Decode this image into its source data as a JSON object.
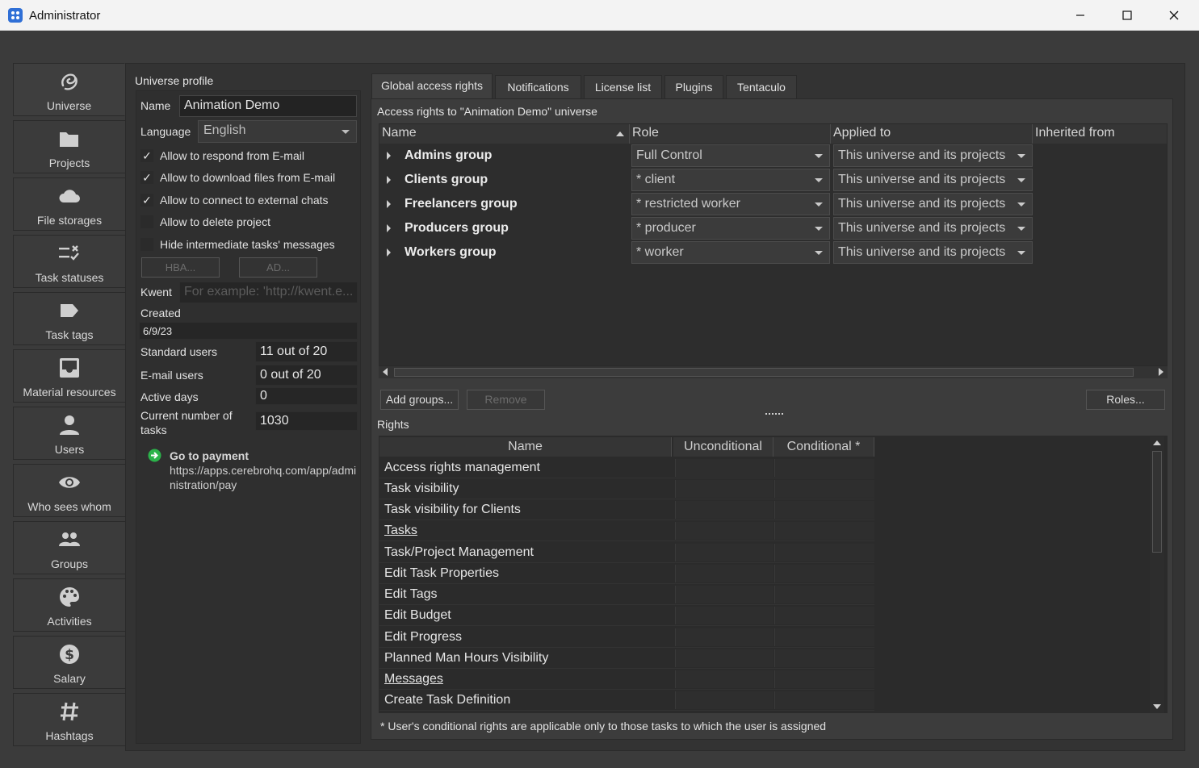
{
  "window": {
    "title": "Administrator"
  },
  "sidebar": {
    "items": [
      {
        "label": "Universe",
        "icon": "universe-icon"
      },
      {
        "label": "Projects",
        "icon": "folder-icon"
      },
      {
        "label": "File storages",
        "icon": "cloud-icon"
      },
      {
        "label": "Task statuses",
        "icon": "task-status-icon"
      },
      {
        "label": "Task tags",
        "icon": "tag-icon"
      },
      {
        "label": "Material resources",
        "icon": "inbox-icon"
      },
      {
        "label": "Users",
        "icon": "user-icon"
      },
      {
        "label": "Who sees whom",
        "icon": "eye-icon"
      },
      {
        "label": "Groups",
        "icon": "groups-icon"
      },
      {
        "label": "Activities",
        "icon": "palette-icon"
      },
      {
        "label": "Salary",
        "icon": "dollar-icon"
      },
      {
        "label": "Hashtags",
        "icon": "hashtag-icon"
      }
    ],
    "active": "Universe"
  },
  "profile": {
    "section_title": "Universe profile",
    "name_label": "Name",
    "name_value": "Animation Demo",
    "language_label": "Language",
    "language_value": "English",
    "checkboxes": [
      {
        "label": "Allow to respond from E-mail",
        "checked": true,
        "mark": "✓"
      },
      {
        "label": "Allow to download files from E-mail",
        "checked": true,
        "mark": "✓"
      },
      {
        "label": "Allow to connect to external chats",
        "checked": true,
        "mark": "✓"
      },
      {
        "label": "Allow to delete project",
        "checked": false,
        "mark": ""
      },
      {
        "label": "Hide intermediate tasks' messages",
        "checked": false,
        "mark": ""
      }
    ],
    "hba_button": "HBA...",
    "ad_button": "AD...",
    "kwent_label": "Kwent",
    "kwent_placeholder": "For example: 'http://kwent.e...",
    "created_label": "Created",
    "created_value": "6/9/23",
    "stats": [
      {
        "label": "Standard users",
        "value": "11 out of 20"
      },
      {
        "label": "E-mail users",
        "value": "0 out of 20"
      },
      {
        "label": "Active days",
        "value": "0"
      },
      {
        "label": "Current number of tasks",
        "value": "1030"
      }
    ],
    "payment_title": "Go to payment",
    "payment_url": "https://apps.cerebrohq.com/app/administration/pay"
  },
  "tabs": [
    "Global access rights",
    "Notifications",
    "License list",
    "Plugins",
    "Tentaculo"
  ],
  "active_tab": "Global access rights",
  "access": {
    "heading": "Access rights to \"Animation Demo\" universe",
    "columns": [
      "Name",
      "Role",
      "Applied to",
      "Inherited from"
    ],
    "groups": [
      {
        "name": "Admins group",
        "role": "Full Control",
        "applied": "This universe and its projects"
      },
      {
        "name": "Clients group",
        "role": "* client",
        "applied": "This universe and its projects"
      },
      {
        "name": "Freelancers group",
        "role": "* restricted worker",
        "applied": "This universe and its projects"
      },
      {
        "name": "Producers group",
        "role": "* producer",
        "applied": "This universe and its projects"
      },
      {
        "name": "Workers group",
        "role": "* worker",
        "applied": "This universe and its projects"
      }
    ],
    "add_groups_button": "Add groups...",
    "remove_button": "Remove",
    "roles_button": "Roles..."
  },
  "rights": {
    "heading": "Rights",
    "columns": [
      "Name",
      "Unconditional",
      "Conditional *"
    ],
    "rows": [
      {
        "name": "Access rights management",
        "link": false
      },
      {
        "name": "Task visibility",
        "link": false
      },
      {
        "name": "Task visibility for Clients",
        "link": false
      },
      {
        "name": "Tasks",
        "link": true
      },
      {
        "name": "Task/Project Management",
        "link": false
      },
      {
        "name": "Edit Task Properties",
        "link": false
      },
      {
        "name": "Edit Tags",
        "link": false
      },
      {
        "name": "Edit Budget",
        "link": false
      },
      {
        "name": "Edit Progress",
        "link": false
      },
      {
        "name": "Planned Man Hours Visibility",
        "link": false
      },
      {
        "name": "Messages",
        "link": true
      },
      {
        "name": "Create Task Definition",
        "link": false
      }
    ],
    "footnote": "* User's conditional rights are applicable only to those tasks to which the user is assigned"
  }
}
